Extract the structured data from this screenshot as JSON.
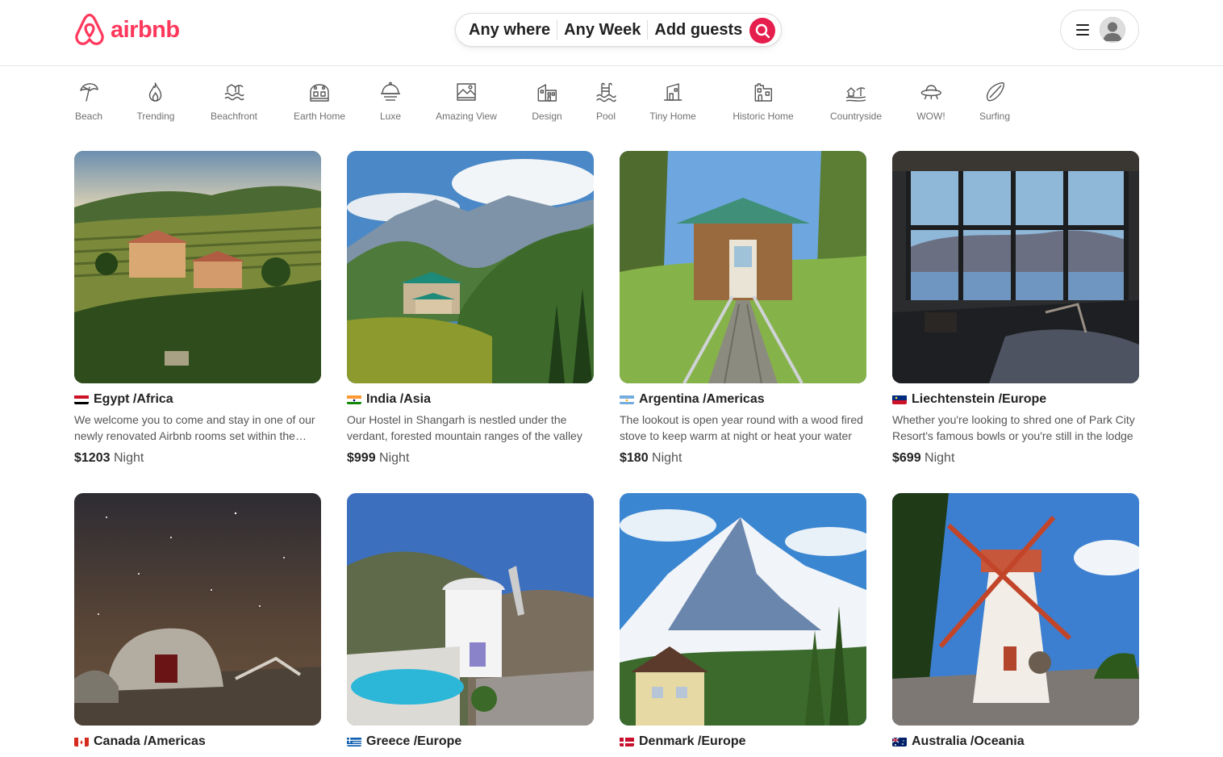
{
  "brand": {
    "name": "airbnb",
    "color": "#ff385c"
  },
  "search": {
    "where": "Any where",
    "when": "Any Week",
    "who": "Add guests",
    "button_color": "#e61e4d"
  },
  "user_menu": {
    "menu_icon": "hamburger-icon",
    "avatar_icon": "user-avatar-icon"
  },
  "categories": [
    {
      "label": "Beach",
      "icon": "umbrella-icon"
    },
    {
      "label": "Trending",
      "icon": "flame-icon"
    },
    {
      "label": "Beachfront",
      "icon": "beachfront-icon"
    },
    {
      "label": "Earth Home",
      "icon": "earth-home-icon"
    },
    {
      "label": "Luxe",
      "icon": "luxe-icon"
    },
    {
      "label": "Amazing View",
      "icon": "view-icon"
    },
    {
      "label": "Design",
      "icon": "design-icon"
    },
    {
      "label": "Pool",
      "icon": "pool-icon"
    },
    {
      "label": "Tiny Home",
      "icon": "tiny-home-icon"
    },
    {
      "label": "Historic Home",
      "icon": "historic-home-icon"
    },
    {
      "label": "Countryside",
      "icon": "countryside-icon"
    },
    {
      "label": "WOW!",
      "icon": "ufo-icon"
    },
    {
      "label": "Surfing",
      "icon": "surfboard-icon"
    }
  ],
  "listings": [
    {
      "title": "Egypt /Africa",
      "description": "We welcome you to come and stay in one of our newly renovated Airbnb rooms set within the estate",
      "price": "$1203",
      "unit": "Night",
      "flag": "egypt"
    },
    {
      "title": "India /Asia",
      "description": "Our Hostel in Shangarh is nestled under the verdant, forested mountain ranges of the valley",
      "price": "$999",
      "unit": "Night",
      "flag": "india"
    },
    {
      "title": "Argentina /Americas",
      "description": "The lookout is open year round with a wood fired stove to keep warm at night or heat your water",
      "price": "$180",
      "unit": "Night",
      "flag": "argentina"
    },
    {
      "title": "Liechtenstein /Europe",
      "description": "Whether you're looking to shred one of Park City Resort's famous bowls or you're still in the lodge",
      "price": "$699",
      "unit": "Night",
      "flag": "liechtenstein"
    },
    {
      "title": "Canada /Americas",
      "description": "",
      "price": "",
      "unit": "",
      "flag": "canada"
    },
    {
      "title": "Greece /Europe",
      "description": "",
      "price": "",
      "unit": "",
      "flag": "greece"
    },
    {
      "title": "Denmark /Europe",
      "description": "",
      "price": "",
      "unit": "",
      "flag": "denmark"
    },
    {
      "title": "Australia /Oceania",
      "description": "",
      "price": "",
      "unit": "",
      "flag": "australia"
    }
  ]
}
